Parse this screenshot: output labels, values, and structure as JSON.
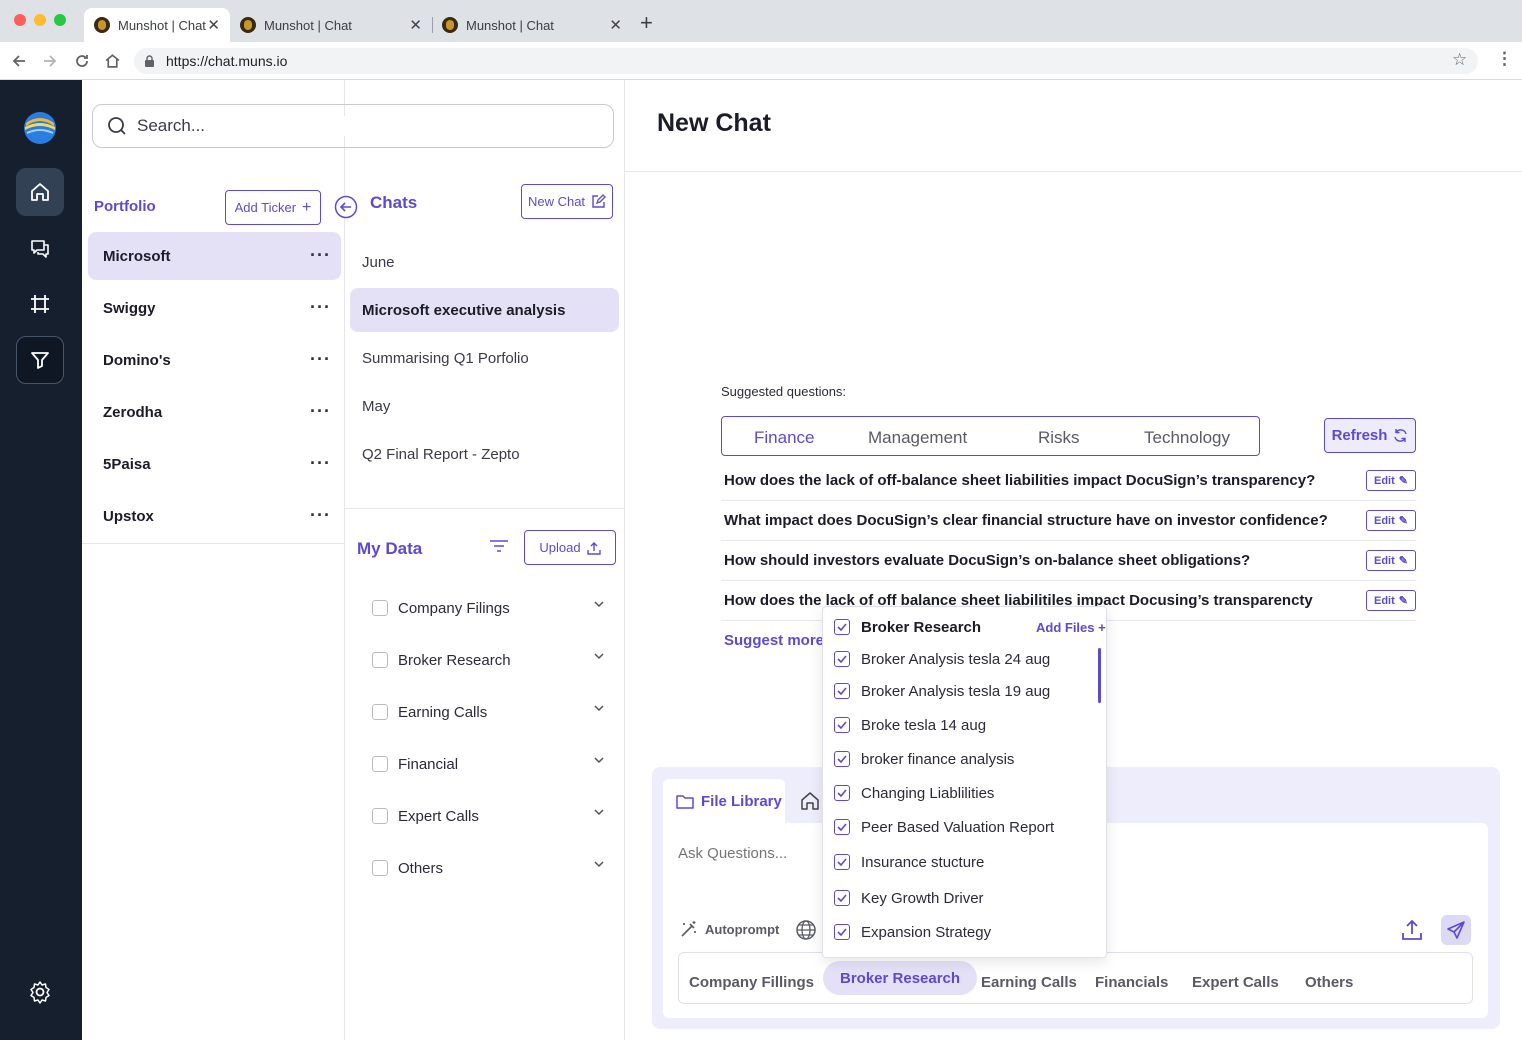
{
  "browser": {
    "tabs": [
      "Munshot | Chat",
      "Munshot | Chat",
      "Munshot | Chat"
    ],
    "url": "https://chat.muns.io"
  },
  "search": {
    "placeholder": "Search..."
  },
  "portfolio": {
    "title": "Portfolio",
    "add_ticker": "Add Ticker",
    "items": [
      "Microsoft",
      "Swiggy",
      "Domino's",
      "Zerodha",
      "5Paisa",
      "Upstox"
    ],
    "selected": "Microsoft"
  },
  "chats": {
    "title": "Chats",
    "new_chat": "New Chat",
    "items": [
      "June",
      "Microsoft executive analysis",
      "Summarising Q1 Porfolio",
      "May",
      "Q2 Final Report - Zepto"
    ],
    "selected": "Microsoft executive analysis"
  },
  "my_data": {
    "title": "My Data",
    "upload": "Upload",
    "items": [
      "Company Filings",
      "Broker Research",
      "Earning Calls",
      "Financial",
      "Expert Calls",
      "Others"
    ]
  },
  "main": {
    "title": "New Chat",
    "suggested_label": "Suggested questions:",
    "tabs": [
      "Finance",
      "Management",
      "Risks",
      "Technology"
    ],
    "active_tab": "Finance",
    "refresh": "Refresh",
    "edit_label": "Edit",
    "questions": [
      "How does the lack of off-balance sheet liabilities impact DocuSign’s transparency?",
      "What impact does DocuSign’s clear financial structure have on investor confidence?",
      "How should investors evaluate DocuSign’s on-balance sheet obligations?",
      "How does the lack of off balance sheet liabilitiles impact Docusing’s transparencty"
    ],
    "suggest_more": "Suggest more"
  },
  "dropdown": {
    "header": "Broker Research",
    "add_files": "Add Files +",
    "items": [
      "Broker Analysis tesla 24 aug",
      "Broker Analysis tesla 19 aug",
      "Broke tesla 14 aug",
      "broker finance analysis",
      "Changing Liablilities",
      "Peer Based Valuation Report",
      "Insurance stucture",
      "Key Growth Driver",
      "Expansion Strategy"
    ]
  },
  "composer": {
    "file_library": "File Library",
    "placeholder": "Ask Questions...",
    "autoprompt": "Autoprompt",
    "bottom_tabs": [
      "Company Fillings",
      "Broker Research",
      "Earning Calls",
      "Financials",
      "Expert Calls",
      "Others"
    ],
    "active_bottom_tab": "Broker Research"
  },
  "colors": {
    "accent": "#5b4bd1",
    "accent_light": "#e4e1f7",
    "rail": "#151f2e"
  }
}
